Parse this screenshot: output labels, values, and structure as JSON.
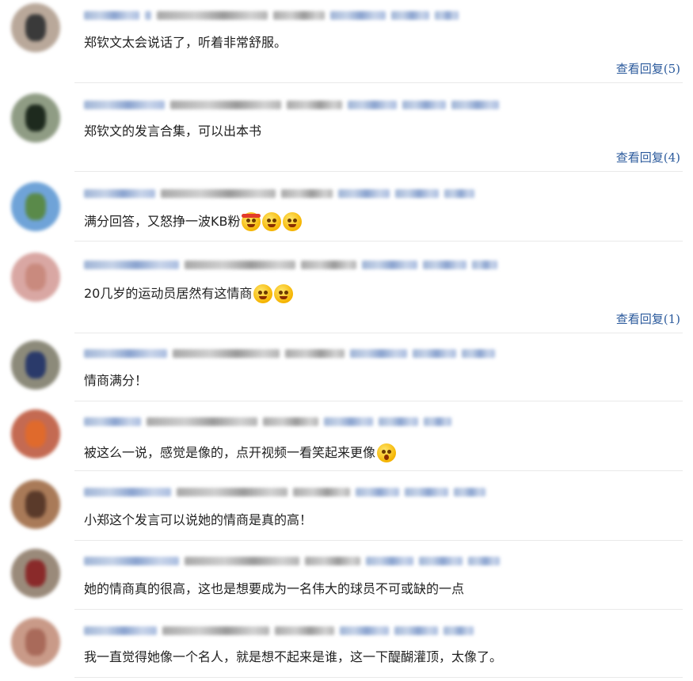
{
  "comments": [
    {
      "text": "郑钦文太会说话了，听着非常舒服。",
      "reply": "查看回复(5)",
      "emojis": []
    },
    {
      "text": "郑钦文的发言合集，可以出本书",
      "reply": "查看回复(4)",
      "emojis": []
    },
    {
      "text": "满分回答，又怒挣一波KB粉",
      "reply": "",
      "emojis": [
        "angry-headband-emoji-icon",
        "smirk-emoji-icon",
        "grin-emoji-icon"
      ]
    },
    {
      "text": "20几岁的运动员居然有这情商",
      "reply": "查看回复(1)",
      "emojis": [
        "smirk-emoji-icon",
        "smirk-emoji-icon"
      ]
    },
    {
      "text": "情商满分！",
      "reply": "",
      "emojis": []
    },
    {
      "text": "被这么一说，感觉是像的，点开视频一看笑起来更像",
      "reply": "",
      "emojis": [
        "shocked-emoji-icon"
      ]
    },
    {
      "text": "小郑这个发言可以说她的情商是真的高！",
      "reply": "",
      "emojis": []
    },
    {
      "text": "她的情商真的很高，这也是想要成为一名伟大的球员不可或缺的一点",
      "reply": "",
      "emojis": []
    },
    {
      "text": "我一直觉得她像一个名人，就是想不起来是谁，这一下醍醐灌顶，太像了。",
      "reply": "",
      "emojis": []
    }
  ],
  "colors": {
    "reply_link": "#2b5a9c",
    "divider": "#e9e9e9",
    "text": "#222222"
  }
}
